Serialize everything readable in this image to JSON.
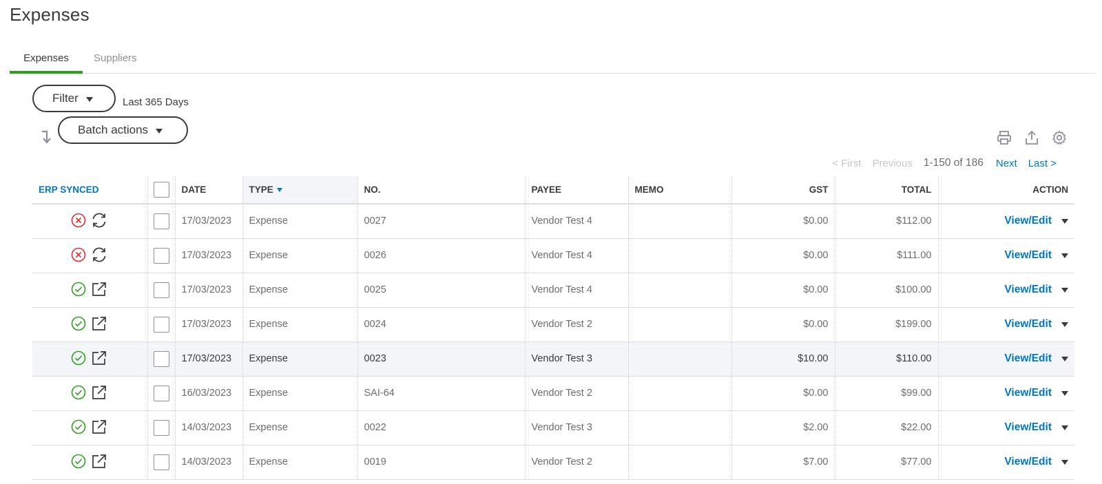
{
  "page": {
    "title": "Expenses"
  },
  "tabs": [
    {
      "label": "Expenses",
      "active": true
    },
    {
      "label": "Suppliers",
      "active": false
    }
  ],
  "filter": {
    "label": "Filter",
    "range": "Last 365 Days"
  },
  "batch": {
    "label": "Batch actions"
  },
  "toolbar": {
    "icons": [
      "print-icon",
      "export-icon",
      "settings-icon"
    ]
  },
  "pager": {
    "first": "< First",
    "previous": "Previous",
    "range": "1-150 of 186",
    "next": "Next",
    "last": "Last >"
  },
  "colors": {
    "accent": "#0077c5",
    "tab_active": "#2ca01c",
    "error": "#e02b2b",
    "success": "#2ca01c"
  },
  "columns": {
    "erp": "ERP SYNCED",
    "date": "DATE",
    "type": "TYPE",
    "no": "NO.",
    "payee": "PAYEE",
    "memo": "MEMO",
    "gst": "GST",
    "total": "TOTAL",
    "action": "ACTION"
  },
  "rows": [
    {
      "status": "error",
      "sync_icon": "refresh-icon",
      "date": "17/03/2023",
      "type": "Expense",
      "no": "0027",
      "payee": "Vendor Test 4",
      "memo": "",
      "gst": "$0.00",
      "total": "$112.00",
      "action": "View/Edit"
    },
    {
      "status": "error",
      "sync_icon": "refresh-icon",
      "date": "17/03/2023",
      "type": "Expense",
      "no": "0026",
      "payee": "Vendor Test 4",
      "memo": "",
      "gst": "$0.00",
      "total": "$111.00",
      "action": "View/Edit"
    },
    {
      "status": "ok",
      "sync_icon": "external-link-icon",
      "date": "17/03/2023",
      "type": "Expense",
      "no": "0025",
      "payee": "Vendor Test 4",
      "memo": "",
      "gst": "$0.00",
      "total": "$100.00",
      "action": "View/Edit"
    },
    {
      "status": "ok",
      "sync_icon": "external-link-icon",
      "date": "17/03/2023",
      "type": "Expense",
      "no": "0024",
      "payee": "Vendor Test 2",
      "memo": "",
      "gst": "$0.00",
      "total": "$199.00",
      "action": "View/Edit"
    },
    {
      "status": "ok",
      "sync_icon": "external-link-icon",
      "date": "17/03/2023",
      "type": "Expense",
      "no": "0023",
      "payee": "Vendor Test 3",
      "memo": "",
      "gst": "$10.00",
      "total": "$110.00",
      "action": "View/Edit"
    },
    {
      "status": "ok",
      "sync_icon": "external-link-icon",
      "date": "16/03/2023",
      "type": "Expense",
      "no": "SAI-64",
      "payee": "Vendor Test 2",
      "memo": "",
      "gst": "$0.00",
      "total": "$99.00",
      "action": "View/Edit"
    },
    {
      "status": "ok",
      "sync_icon": "external-link-icon",
      "date": "14/03/2023",
      "type": "Expense",
      "no": "0022",
      "payee": "Vendor Test 3",
      "memo": "",
      "gst": "$2.00",
      "total": "$22.00",
      "action": "View/Edit"
    },
    {
      "status": "ok",
      "sync_icon": "external-link-icon",
      "date": "14/03/2023",
      "type": "Expense",
      "no": "0019",
      "payee": "Vendor Test 2",
      "memo": "",
      "gst": "$7.00",
      "total": "$77.00",
      "action": "View/Edit"
    }
  ]
}
